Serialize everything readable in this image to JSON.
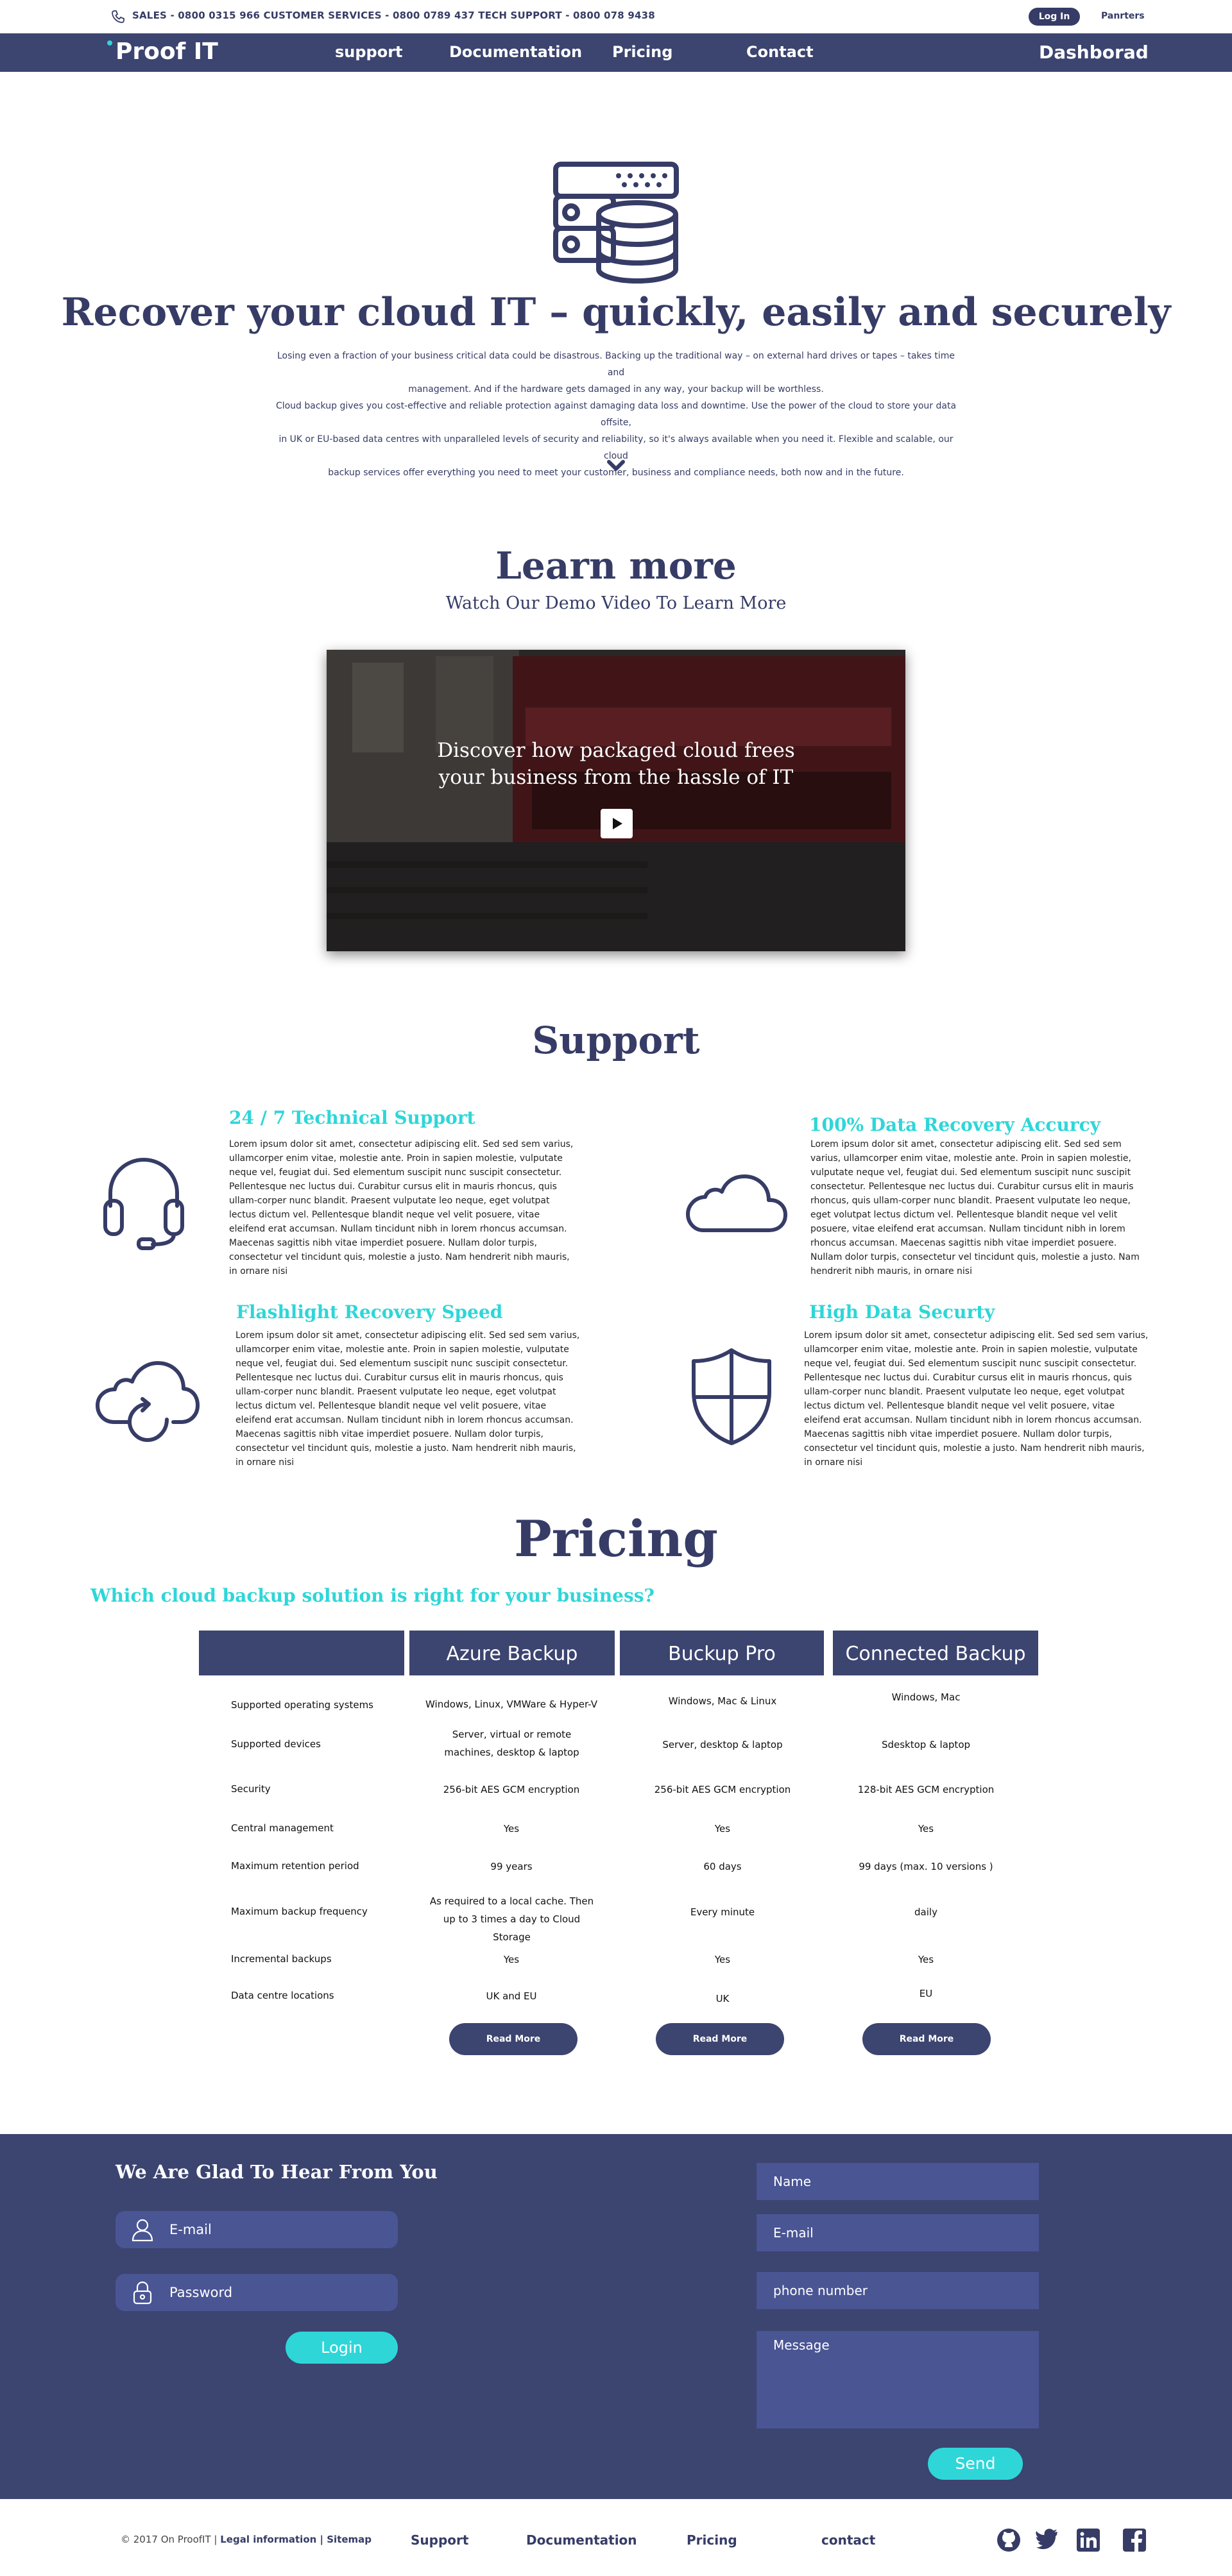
{
  "topbar": {
    "contacts": "SALES - 0800 0315 966 CUSTOMER SERVICES - 0800 0789 437 TECH SUPPORT - 0800 078 9438",
    "login_label": "Log In",
    "partners_label": "Panrters"
  },
  "nav": {
    "logo": "Proof IT",
    "items": [
      "support",
      "Documentation",
      "Pricing",
      "Contact"
    ],
    "dashboard": "Dashborad"
  },
  "hero": {
    "title": "Recover your  cloud IT – quickly, easily and securely",
    "lines": [
      "Losing even a fraction of your business critical data could be disastrous. Backing up the traditional way – on external hard drives or tapes – takes time and",
      "management. And if the hardware gets damaged in any way, your backup will be worthless.",
      "Cloud backup gives you cost-effective and reliable protection against damaging data loss and downtime. Use the power of the cloud to store your data offsite,",
      "in UK or EU-based data centres with unparalleled levels of security and reliability, so it's always available when you need it. Flexible and scalable, our cloud",
      "backup services offer everything you need to meet your customer, business and compliance needs, both now and in the future."
    ]
  },
  "learn": {
    "title": "Learn more",
    "subtitle": "Watch Our Demo Video To Learn More",
    "video_caption_1": "Discover how packaged cloud frees",
    "video_caption_2": "your business from the hassle of IT"
  },
  "support": {
    "title": "Support",
    "features": [
      {
        "title": "24 / 7  Technical Support",
        "icon": "headset-icon",
        "body": "Lorem ipsum dolor sit amet, consectetur adipiscing elit. Sed sed sem varius, ullamcorper enim vitae, molestie ante. Proin in sapien molestie, vulputate neque vel, feugiat dui. Sed elementum suscipit nunc suscipit consectetur. Pellentesque nec luctus dui. Curabitur cursus elit in mauris rhoncus, quis ullam-corper nunc blandit. Praesent vulputate leo neque, eget volutpat lectus dictum vel. Pellentesque blandit neque vel velit posuere, vitae eleifend erat accumsan. Nullam tincidunt nibh in lorem rhoncus accumsan. Maecenas sagittis nibh vitae imperdiet posuere. Nullam dolor turpis, consectetur vel tincidunt quis, molestie a justo. Nam hendrerit nibh mauris, in ornare nisi"
      },
      {
        "title": "100% Data Recovery Accurcy",
        "icon": "cloud-icon",
        "body": "Lorem ipsum dolor sit amet, consectetur adipiscing elit. Sed sed sem varius, ullamcorper enim vitae, molestie ante. Proin in sapien molestie, vulputate neque vel, feugiat dui. Sed elementum suscipit nunc suscipit consectetur. Pellentesque nec luctus dui. Curabitur cursus elit in mauris rhoncus, quis ullam-corper nunc blandit. Praesent vulputate leo neque, eget volutpat lectus dictum vel. Pellentesque blandit neque vel velit posuere, vitae eleifend erat accumsan. Nullam tincidunt nibh in lorem rhoncus accumsan. Maecenas sagittis nibh vitae imperdiet posuere. Nullam dolor turpis, consectetur vel tincidunt quis, molestie a justo. Nam hendrerit nibh mauris, in ornare nisi"
      },
      {
        "title": "Flashlight Recovery Speed",
        "icon": "cloud-refresh-icon",
        "body": "Lorem ipsum dolor sit amet, consectetur adipiscing elit. Sed sed sem varius, ullamcorper enim vitae, molestie ante. Proin in sapien molestie, vulputate neque vel, feugiat dui. Sed elementum suscipit nunc suscipit consectetur. Pellentesque nec luctus dui. Curabitur cursus elit in mauris rhoncus, quis ullam-corper nunc blandit. Praesent vulputate leo neque, eget volutpat lectus dictum vel. Pellentesque blandit neque vel velit posuere, vitae eleifend erat accumsan. Nullam tincidunt nibh in lorem rhoncus accumsan. Maecenas sagittis nibh vitae imperdiet posuere. Nullam dolor turpis, consectetur vel tincidunt quis, molestie a justo. Nam hendrerit nibh mauris, in ornare nisi"
      },
      {
        "title": "High Data Securty",
        "icon": "shield-icon",
        "body": "Lorem ipsum dolor sit amet, consectetur adipiscing elit. Sed sed sem varius, ullamcorper enim vitae, molestie ante. Proin in sapien molestie, vulputate neque vel, feugiat dui. Sed elementum suscipit nunc suscipit consectetur. Pellentesque nec luctus dui. Curabitur cursus elit in mauris rhoncus, quis ullam-corper nunc blandit. Praesent vulputate leo neque, eget volutpat lectus dictum vel. Pellentesque blandit neque vel velit posuere, vitae eleifend erat accumsan. Nullam tincidunt nibh in lorem rhoncus accumsan. Maecenas sagittis nibh vitae imperdiet posuere. Nullam dolor turpis, consectetur vel tincidunt quis, molestie a justo. Nam hendrerit nibh mauris, in ornare nisi"
      }
    ]
  },
  "pricing": {
    "title": "Pricing",
    "subtitle": "Which cloud backup solution is right for your business?",
    "plans": [
      "Azure Backup",
      "Buckup Pro",
      "Connected Backup"
    ],
    "rows": [
      {
        "label": "Supported operating systems",
        "values": [
          "Windows, Linux, VMWare & Hyper-V",
          "Windows, Mac & Linux",
          "Windows, Mac"
        ]
      },
      {
        "label": "Supported devices",
        "values": [
          "Server, virtual or remote machines, desktop & laptop",
          "Server, desktop & laptop",
          "Sdesktop & laptop"
        ]
      },
      {
        "label": "Security",
        "values": [
          "256-bit AES GCM encryption",
          "256-bit AES GCM encryption",
          "128-bit AES GCM encryption"
        ]
      },
      {
        "label": "Central management",
        "values": [
          "Yes",
          "Yes",
          "Yes"
        ]
      },
      {
        "label": "Maximum retention period",
        "values": [
          "99 years",
          "60 days",
          "99 days (max. 10 versions )"
        ]
      },
      {
        "label": "Maximum backup frequency",
        "values": [
          "As required to a local cache. Then up to 3 times a day to Cloud Storage",
          "Every minute",
          "daily"
        ]
      },
      {
        "label": "Incremental backups",
        "values": [
          "Yes",
          "Yes",
          "Yes"
        ]
      },
      {
        "label": "Data centre locations",
        "values": [
          "UK and EU",
          "UK",
          "EU"
        ]
      }
    ],
    "read_more": "Read More"
  },
  "contact": {
    "title": "We Are Glad To Hear From You",
    "email_placeholder": "E-mail",
    "password_placeholder": "Password",
    "login_label": "Login",
    "form": {
      "name": "Name",
      "email": "E-mail",
      "phone": "phone number",
      "message": "Message"
    },
    "send_label": "Send"
  },
  "footer": {
    "copyright": "© 2017 On ProofIT",
    "legal": "Legal information",
    "sitemap": "Sitemap",
    "links": [
      "Support",
      "Documentation",
      "Pricing",
      "contact"
    ],
    "social": [
      "github-icon",
      "twitter-icon",
      "linkedin-icon",
      "facebook-icon"
    ]
  },
  "colors": {
    "navy": "#3c4470",
    "text": "#363c66",
    "accent": "#2ed6d8",
    "input": "#4a5594"
  }
}
